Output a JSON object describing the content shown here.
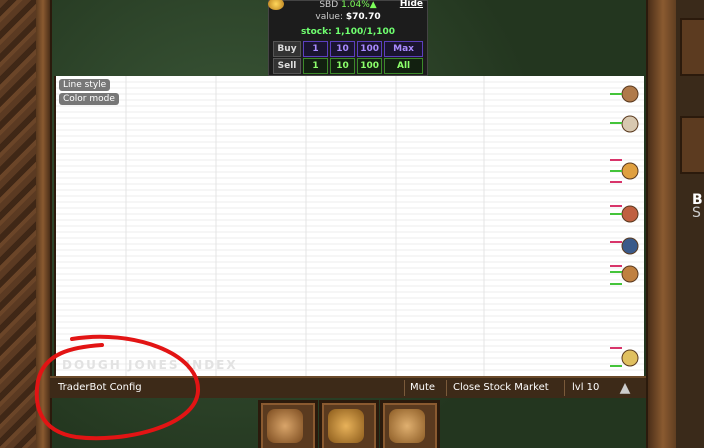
{
  "stock_panel": {
    "symbol": "SBD",
    "change": "1.04%▲",
    "hide_label": "Hide",
    "value_label": "value:",
    "value": "$70.70",
    "stock_label": "stock: 1,100/1,100",
    "buy_label": "Buy",
    "sell_label": "Sell",
    "buy_options": [
      "1",
      "10",
      "100",
      "Max"
    ],
    "sell_options": [
      "1",
      "10",
      "100",
      "All"
    ]
  },
  "chart": {
    "line_style_label": "Line style",
    "color_mode_label": "Color mode",
    "watermark": "DOUGH JONES INDEX"
  },
  "bottom_bar": {
    "config_label": "TraderBot Config",
    "mute_label": "Mute",
    "close_label": "Close Stock Market",
    "level_label": "lvl 10"
  },
  "right_panel": {
    "letter_top": "B",
    "letter_bottom": "S"
  },
  "colors": {
    "annotation": "#e21414",
    "up": "#44c43a",
    "down": "#d8346a"
  },
  "icons": {
    "goods": [
      "cookie-icon",
      "scroll-icon",
      "cake-icon",
      "meat-icon",
      "potion-icon",
      "bread-icon",
      "burger-icon"
    ],
    "buildings": [
      "cow-icon",
      "dragon-icon",
      "fist-icon"
    ]
  }
}
